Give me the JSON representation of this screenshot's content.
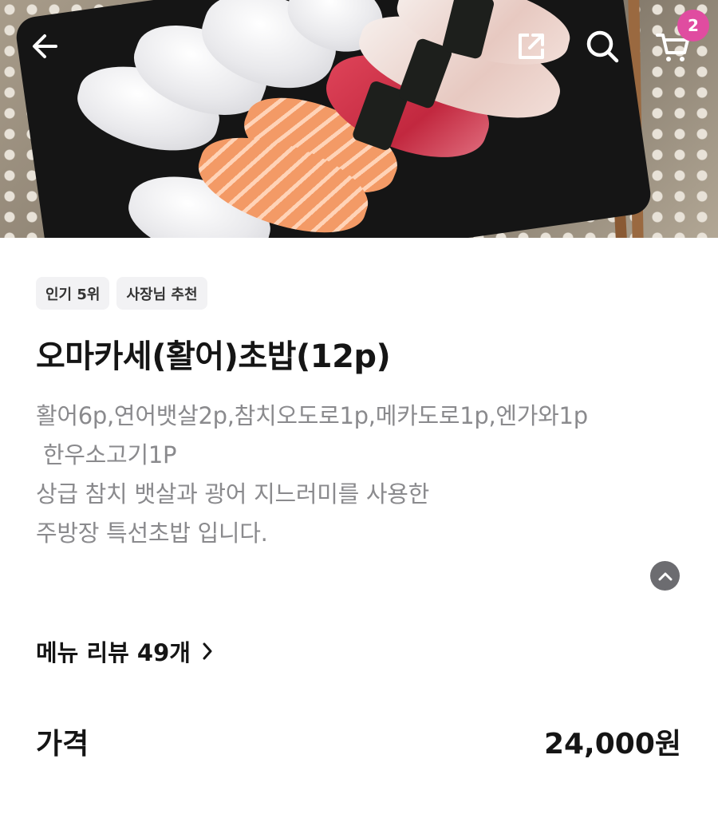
{
  "header": {
    "back_icon": "arrow-left-icon",
    "share_icon": "share-external-icon",
    "search_icon": "search-icon",
    "cart_icon": "cart-icon",
    "cart_count": "2",
    "badge_color": "#e04ca0"
  },
  "hero": {
    "image_alt": "오마카세(활어)초밥(12p)"
  },
  "tags": [
    "인기 5위",
    "사장님 추천"
  ],
  "menu": {
    "title": "오마카세(활어)초밥(12p)",
    "description": [
      "활어6p,연어뱃살2p,참치오도로1p,메카도로1p,엔가와1p",
      " 한우소고기1P",
      "상급 참치 뱃살과 광어 지느러미를 사용한",
      "주방장 특선초밥 입니다."
    ],
    "collapse_icon": "chevron-up-icon"
  },
  "review": {
    "label": "메뉴 리뷰 49개",
    "chevron_icon": "chevron-right-icon"
  },
  "price": {
    "label": "가격",
    "value": "24,000원"
  }
}
